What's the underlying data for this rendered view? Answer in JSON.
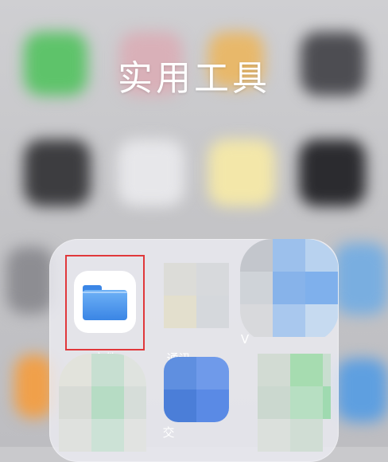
{
  "folder": {
    "title": "实用工具",
    "apps": [
      {
        "label": "文件",
        "icon": "files-folder-icon"
      },
      {
        "label": "通讯…",
        "icon": "obscured-app-icon"
      },
      {
        "label": "V",
        "icon": "obscured-app-icon"
      },
      {
        "label": "",
        "icon": "obscured-app-icon"
      },
      {
        "label": "交",
        "icon": "obscured-app-icon"
      },
      {
        "label": "",
        "icon": "obscured-app-icon"
      }
    ]
  },
  "annotation": {
    "color": "#e0383b",
    "target": "files-app"
  },
  "colors": {
    "files_blue": "#3a85e5",
    "facetime_green": "#5ec36a"
  }
}
